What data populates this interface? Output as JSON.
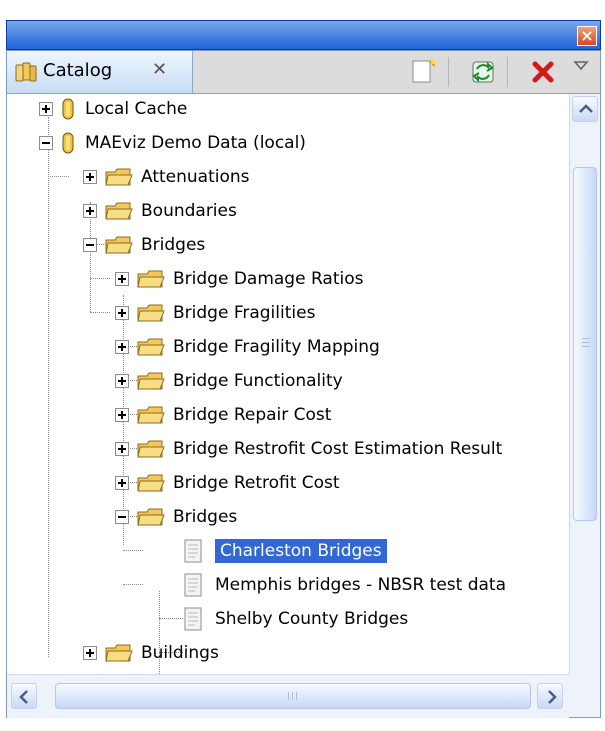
{
  "window": {
    "close_glyph": "×"
  },
  "tabs": [
    {
      "label": "Catalog",
      "close_glyph": "✕"
    }
  ],
  "toolbar": {
    "new_icon": "new-catalog-icon",
    "refresh_icon": "refresh-icon",
    "delete_icon": "delete-icon",
    "menu_icon": "view-menu-icon"
  },
  "tree": {
    "items": [
      {
        "label": "Local Cache"
      },
      {
        "label": "MAEviz Demo Data (local)"
      },
      {
        "label": "Attenuations"
      },
      {
        "label": "Boundaries"
      },
      {
        "label": "Bridges"
      },
      {
        "label": "Bridge Damage Ratios"
      },
      {
        "label": "Bridge Fragilities"
      },
      {
        "label": "Bridge Fragility Mapping"
      },
      {
        "label": "Bridge Functionality"
      },
      {
        "label": "Bridge Repair Cost"
      },
      {
        "label": "Bridge Restrofit Cost Estimation Result"
      },
      {
        "label": "Bridge Retrofit Cost"
      },
      {
        "label": "Bridges"
      },
      {
        "label": "Charleston Bridges",
        "selected": true
      },
      {
        "label": "Memphis bridges - NBSR test data"
      },
      {
        "label": "Shelby County Bridges"
      },
      {
        "label": "Buildings"
      }
    ]
  },
  "colors": {
    "selection": "#3168d5",
    "title_bar": "#1f64d8",
    "folder": "#f2c85a"
  }
}
